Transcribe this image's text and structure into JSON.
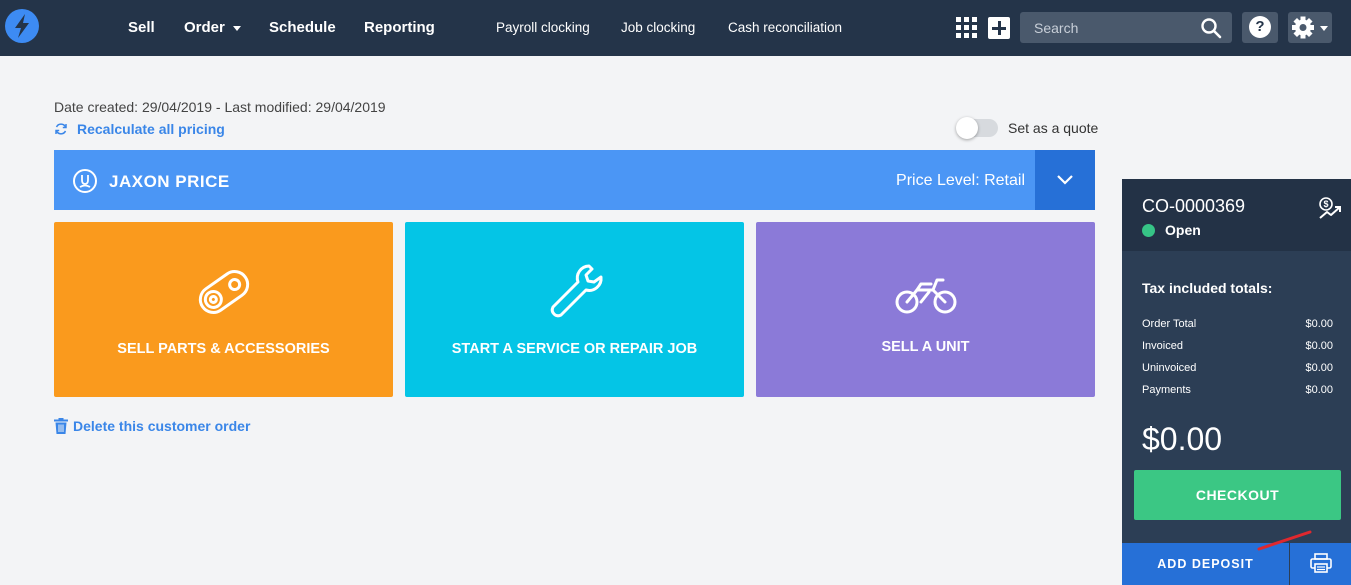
{
  "nav": {
    "items": [
      {
        "label": "Sell"
      },
      {
        "label": "Order"
      },
      {
        "label": "Schedule"
      },
      {
        "label": "Reporting"
      }
    ],
    "sub_items": [
      {
        "label": "Payroll clocking"
      },
      {
        "label": "Job clocking"
      },
      {
        "label": "Cash reconciliation"
      }
    ],
    "search_placeholder": "Search",
    "help_label": "?"
  },
  "order": {
    "meta": "Date created: 29/04/2019 - Last modified: 29/04/2019",
    "recalc_label": "Recalculate all pricing",
    "quote_label": "Set as a quote",
    "customer_name": "JAXON PRICE",
    "price_level": "Price Level: Retail",
    "delete_label": "Delete this customer order"
  },
  "tiles": [
    {
      "label": "SELL PARTS & ACCESSORIES",
      "icon": "parts-icon",
      "color": "#fa9a1d"
    },
    {
      "label": "START A SERVICE OR REPAIR JOB",
      "icon": "wrench-icon",
      "color": "#04c5e6"
    },
    {
      "label": "SELL A UNIT",
      "icon": "motorbike-icon",
      "color": "#8b7ad8"
    }
  ],
  "panel": {
    "order_number": "CO-0000369",
    "status": "Open",
    "tax_heading": "Tax included totals:",
    "rows": [
      {
        "label": "Order Total",
        "value": "$0.00"
      },
      {
        "label": "Invoiced",
        "value": "$0.00"
      },
      {
        "label": "Uninvoiced",
        "value": "$0.00"
      },
      {
        "label": "Payments",
        "value": "$0.00"
      }
    ],
    "grand_total": "$0.00",
    "checkout_label": "CHECKOUT",
    "deposit_label": "ADD DEPOSIT"
  },
  "colors": {
    "nav_bg": "#243449",
    "accent_blue": "#4b96f5",
    "dark_blue": "#2670d7",
    "success": "#3bc784",
    "link": "#3a86e8"
  }
}
